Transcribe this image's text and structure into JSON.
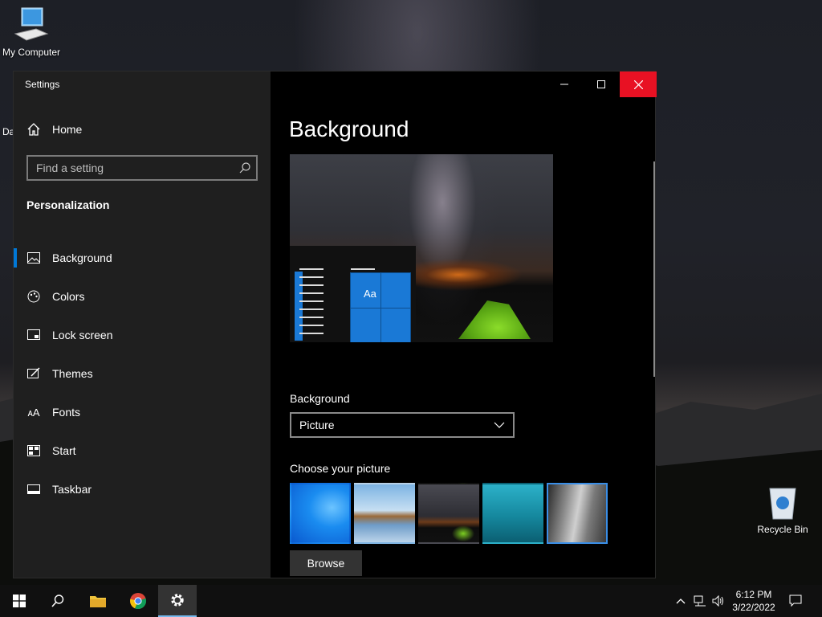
{
  "desktop": {
    "icons": [
      {
        "label": "My Computer"
      },
      {
        "label": "Da"
      },
      {
        "label": "Recycle Bin"
      }
    ]
  },
  "window": {
    "title": "Settings",
    "controls": {
      "minimize": "minimize-icon",
      "maximize": "maximize-icon",
      "close": "close-icon"
    }
  },
  "sidebar": {
    "home_label": "Home",
    "search": {
      "placeholder": "Find a setting",
      "value": ""
    },
    "section": "Personalization",
    "items": [
      {
        "label": "Background",
        "icon": "picture-icon",
        "active": true
      },
      {
        "label": "Colors",
        "icon": "palette-icon",
        "active": false
      },
      {
        "label": "Lock screen",
        "icon": "lock-screen-icon",
        "active": false
      },
      {
        "label": "Themes",
        "icon": "themes-icon",
        "active": false
      },
      {
        "label": "Fonts",
        "icon": "fonts-icon",
        "active": false
      },
      {
        "label": "Start",
        "icon": "start-icon",
        "active": false
      },
      {
        "label": "Taskbar",
        "icon": "taskbar-icon",
        "active": false
      }
    ]
  },
  "content": {
    "title": "Background",
    "preview": {
      "sample_text": "Aa"
    },
    "background_label": "Background",
    "background_value": "Picture",
    "choose_label": "Choose your picture",
    "browse_label": "Browse"
  },
  "taskbar": {
    "time": "6:12 PM",
    "date": "3/22/2022"
  },
  "colors": {
    "accent": "#0078d7",
    "close_red": "#e81123",
    "sidebar_bg": "#1f1f1f",
    "content_bg": "#000000"
  }
}
